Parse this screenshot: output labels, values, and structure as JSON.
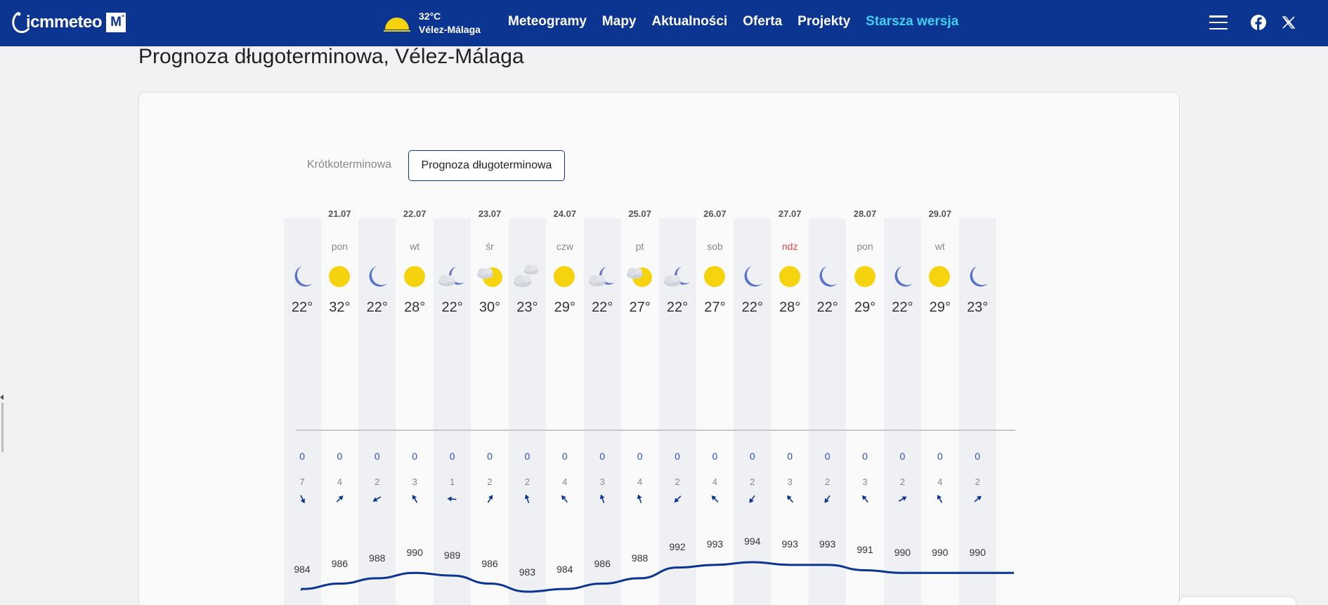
{
  "header": {
    "logo_text": "icmmeteo",
    "logo_badge": "M",
    "logo_badge_sup": "°",
    "current": {
      "temp": "32°C",
      "place": "Vélez-Málaga",
      "icon": "sun-icon"
    },
    "nav": [
      {
        "label": "Meteogramy"
      },
      {
        "label": "Mapy"
      },
      {
        "label": "Aktualności"
      },
      {
        "label": "Oferta"
      },
      {
        "label": "Projekty"
      },
      {
        "label": "Starsza wersja",
        "accent": "#3fd0f0"
      }
    ],
    "icons": [
      "menu-icon",
      "facebook-icon",
      "x-icon"
    ]
  },
  "page_title": "Prognoza długoterminowa, Vélez-Málaga",
  "tabs": {
    "short": "Krótkoterminowa",
    "long": "Prognoza długoterminowa"
  },
  "colors": {
    "brand": "#0b3591",
    "accent": "#3fd0f0",
    "sunday": "#e84545",
    "sun": "#f5d40f",
    "moon": "#5b74c9",
    "pressure_line": "#0b3591"
  },
  "forecast": [
    {
      "date": "",
      "day": "",
      "icon": "moon",
      "temp": "22°",
      "precip": "0",
      "wind": "7",
      "wind_dir": 155,
      "pressure": "984"
    },
    {
      "date": "21.07",
      "day": "pon",
      "icon": "sun",
      "temp": "32°",
      "precip": "0",
      "wind": "4",
      "wind_dir": 45,
      "pressure": "986"
    },
    {
      "date": "",
      "day": "",
      "icon": "moon",
      "temp": "22°",
      "precip": "0",
      "wind": "2",
      "wind_dir": 240,
      "pressure": "988"
    },
    {
      "date": "22.07",
      "day": "wt",
      "icon": "sun",
      "temp": "28°",
      "precip": "0",
      "wind": "3",
      "wind_dir": 330,
      "pressure": "990"
    },
    {
      "date": "",
      "day": "",
      "icon": "moon-cloud",
      "temp": "22°",
      "precip": "0",
      "wind": "1",
      "wind_dir": 275,
      "pressure": "989"
    },
    {
      "date": "23.07",
      "day": "śr",
      "icon": "sun-cloud",
      "temp": "30°",
      "precip": "0",
      "wind": "2",
      "wind_dir": 30,
      "pressure": "986"
    },
    {
      "date": "",
      "day": "",
      "icon": "cloud",
      "temp": "23°",
      "precip": "0",
      "wind": "2",
      "wind_dir": 340,
      "pressure": "983"
    },
    {
      "date": "24.07",
      "day": "czw",
      "icon": "sun",
      "temp": "29°",
      "precip": "0",
      "wind": "4",
      "wind_dir": 320,
      "pressure": "984"
    },
    {
      "date": "",
      "day": "",
      "icon": "moon-cloud",
      "temp": "22°",
      "precip": "0",
      "wind": "3",
      "wind_dir": 340,
      "pressure": "986"
    },
    {
      "date": "25.07",
      "day": "pt",
      "icon": "sun-cloud",
      "temp": "27°",
      "precip": "0",
      "wind": "4",
      "wind_dir": 340,
      "pressure": "988"
    },
    {
      "date": "",
      "day": "",
      "icon": "moon-cloud",
      "temp": "22°",
      "precip": "0",
      "wind": "2",
      "wind_dir": 225,
      "pressure": "992"
    },
    {
      "date": "26.07",
      "day": "sob",
      "icon": "sun",
      "temp": "27°",
      "precip": "0",
      "wind": "4",
      "wind_dir": 315,
      "pressure": "993"
    },
    {
      "date": "",
      "day": "",
      "icon": "moon",
      "temp": "22°",
      "precip": "0",
      "wind": "2",
      "wind_dir": 215,
      "pressure": "994"
    },
    {
      "date": "27.07",
      "day": "ndz",
      "icon": "sun",
      "temp": "28°",
      "precip": "0",
      "wind": "3",
      "wind_dir": 320,
      "pressure": "993",
      "sunday": true
    },
    {
      "date": "",
      "day": "",
      "icon": "moon",
      "temp": "22°",
      "precip": "0",
      "wind": "2",
      "wind_dir": 215,
      "pressure": "993"
    },
    {
      "date": "28.07",
      "day": "pon",
      "icon": "sun",
      "temp": "29°",
      "precip": "0",
      "wind": "3",
      "wind_dir": 320,
      "pressure": "991"
    },
    {
      "date": "",
      "day": "",
      "icon": "moon",
      "temp": "22°",
      "precip": "0",
      "wind": "2",
      "wind_dir": 60,
      "pressure": "990"
    },
    {
      "date": "29.07",
      "day": "wt",
      "icon": "sun",
      "temp": "29°",
      "precip": "0",
      "wind": "4",
      "wind_dir": 330,
      "pressure": "990"
    },
    {
      "date": "",
      "day": "",
      "icon": "moon",
      "temp": "23°",
      "precip": "0",
      "wind": "2",
      "wind_dir": 50,
      "pressure": "990"
    }
  ]
}
